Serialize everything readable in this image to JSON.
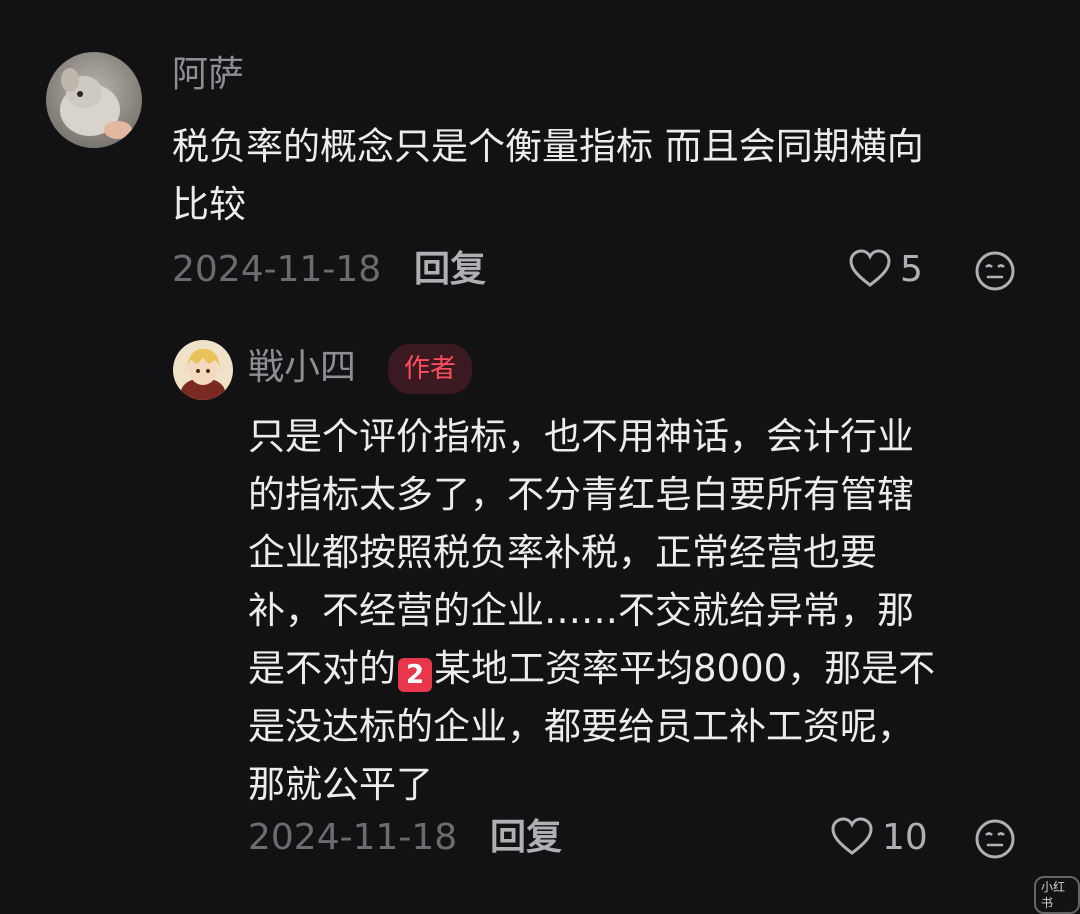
{
  "comment": {
    "username": "阿萨",
    "text_line1": "税负率的概念只是个衡量指标 而且会同期横向",
    "text_line2": "比较",
    "date": "2024-11-18",
    "reply_label": "回复",
    "like_count": "5"
  },
  "reply": {
    "username": "戦小四",
    "badge": "作者",
    "lines": [
      "只是个评价指标，也不用神话，会计行业",
      "的指标太多了，不分青红皂白要所有管辖",
      "企业都按照税负率补税，正常经营也要",
      "补，不经营的企业……不交就给异常，那"
    ],
    "line5_before": "是不对的",
    "emoji_number": "2",
    "line5_after": "某地工资率平均8000，那是不",
    "lines_tail": [
      "是没达标的企业，都要给员工补工资呢，",
      "那就公平了"
    ],
    "date": "2024-11-18",
    "reply_label": "回复",
    "like_count": "10"
  },
  "watermark": "小红书",
  "icons": {
    "like": "heart-outline-icon",
    "emoji": "emoji-face-icon"
  },
  "colors": {
    "background": "#121214",
    "author_badge_text": "#ff4d5e",
    "author_badge_bg": "#3a1a20",
    "emoji_red": "#e8364b"
  }
}
